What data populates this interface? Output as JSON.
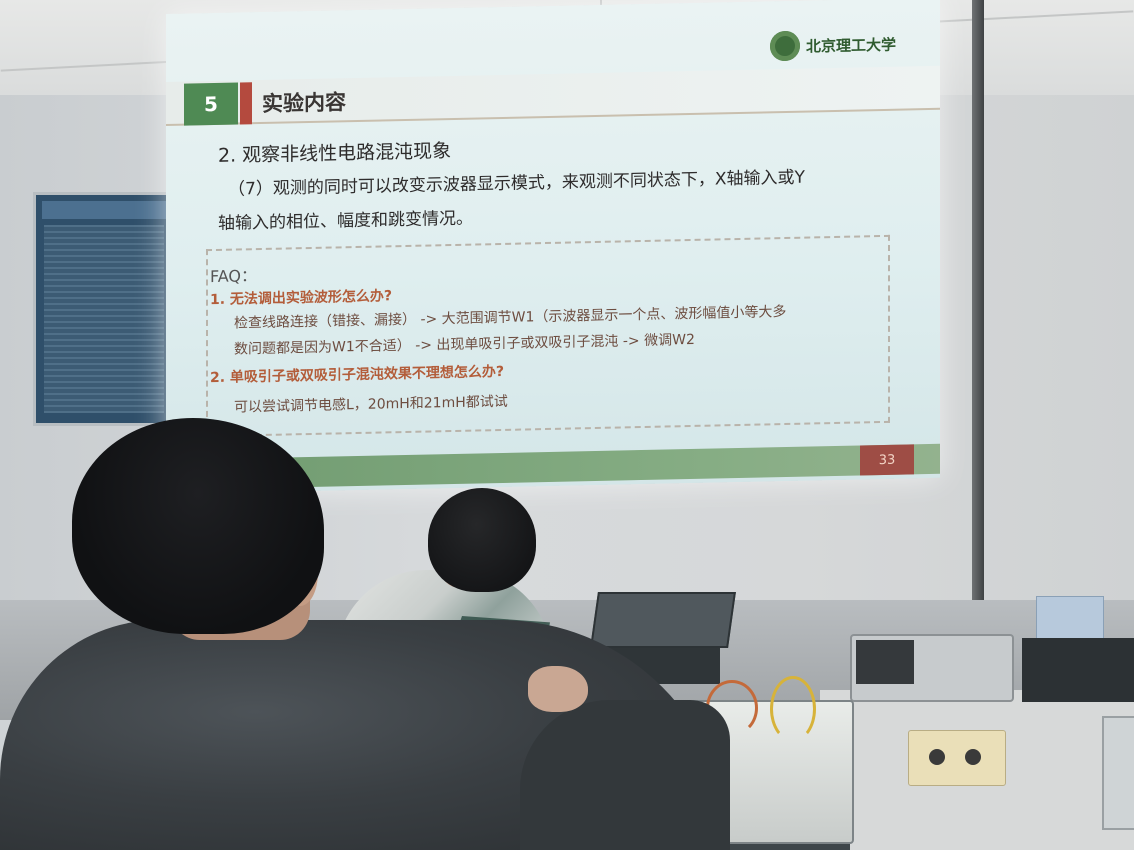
{
  "slide": {
    "section_number": "5",
    "section_title": "实验内容",
    "logo_text": "北京理工大学",
    "heading": "2. 观察非线性电路混沌现象",
    "paragraph_line1": "（7）观测的同时可以改变示波器显示模式，来观测不同状态下，X轴输入或Y",
    "paragraph_line2": "轴输入的相位、幅度和跳变情况。",
    "faq": {
      "title": "FAQ：",
      "q1": "1.   无法调出实验波形怎么办?",
      "a1_line1": "检查线路连接（错接、漏接） -> 大范围调节W1（示波器显示一个点、波形幅值小等大多",
      "a1_line2": "数问题都是因为W1不合适） -> 出现单吸引子或双吸引子混沌 -> 微调W2",
      "q2": "2.   单吸引子或双吸引子混沌效果不理想怎么办?",
      "a2": "可以尝试调节电感L，20mH和21mH都试试"
    },
    "page_number": "33"
  },
  "colors": {
    "slide_bg": "#e3efef",
    "section_green": "#4f8a54",
    "accent_red": "#b44a3e",
    "footer_green": "#7ea57c",
    "faq_question": "#b35d3a"
  }
}
